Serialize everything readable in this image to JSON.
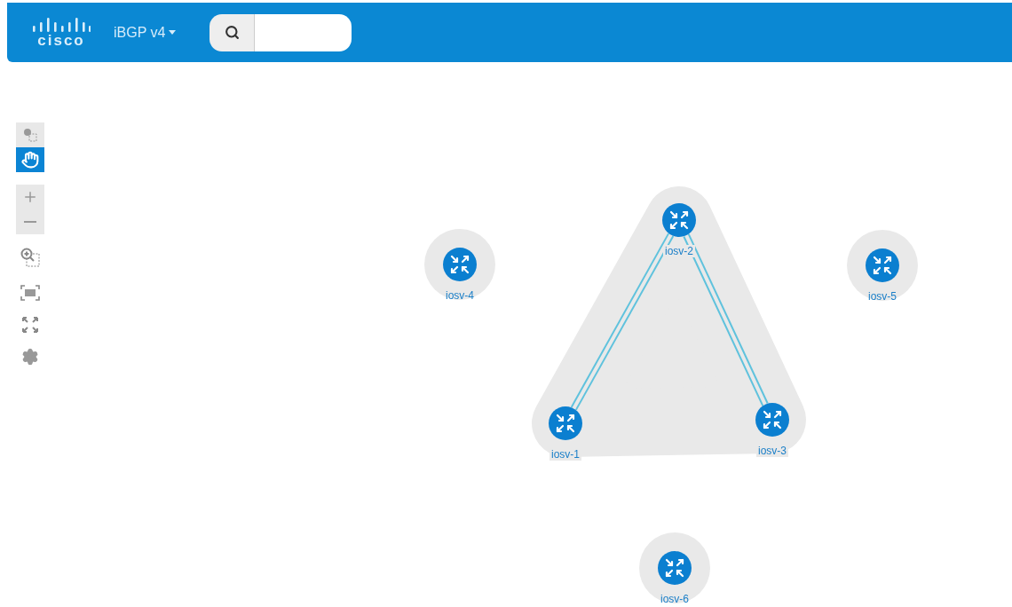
{
  "header": {
    "logo_text": "cisco",
    "project": "iBGP v4"
  },
  "tools": [
    {
      "kind": "select",
      "selected": false
    },
    {
      "kind": "pan",
      "selected": true
    },
    {
      "kind": "zoom-in"
    },
    {
      "kind": "zoom-out"
    },
    {
      "kind": "zoom-region"
    },
    {
      "kind": "fit"
    },
    {
      "kind": "expand"
    },
    {
      "kind": "settings"
    }
  ],
  "topology": {
    "group": [
      {
        "label": "iosv-2",
        "connected": false
      },
      {
        "label": "iosv-1",
        "connected": true
      },
      {
        "label": "iosv-3",
        "connected": true
      }
    ],
    "singles": [
      {
        "label": "iosv-4"
      },
      {
        "label": "iosv-5"
      },
      {
        "label": "iosv-6"
      }
    ]
  }
}
